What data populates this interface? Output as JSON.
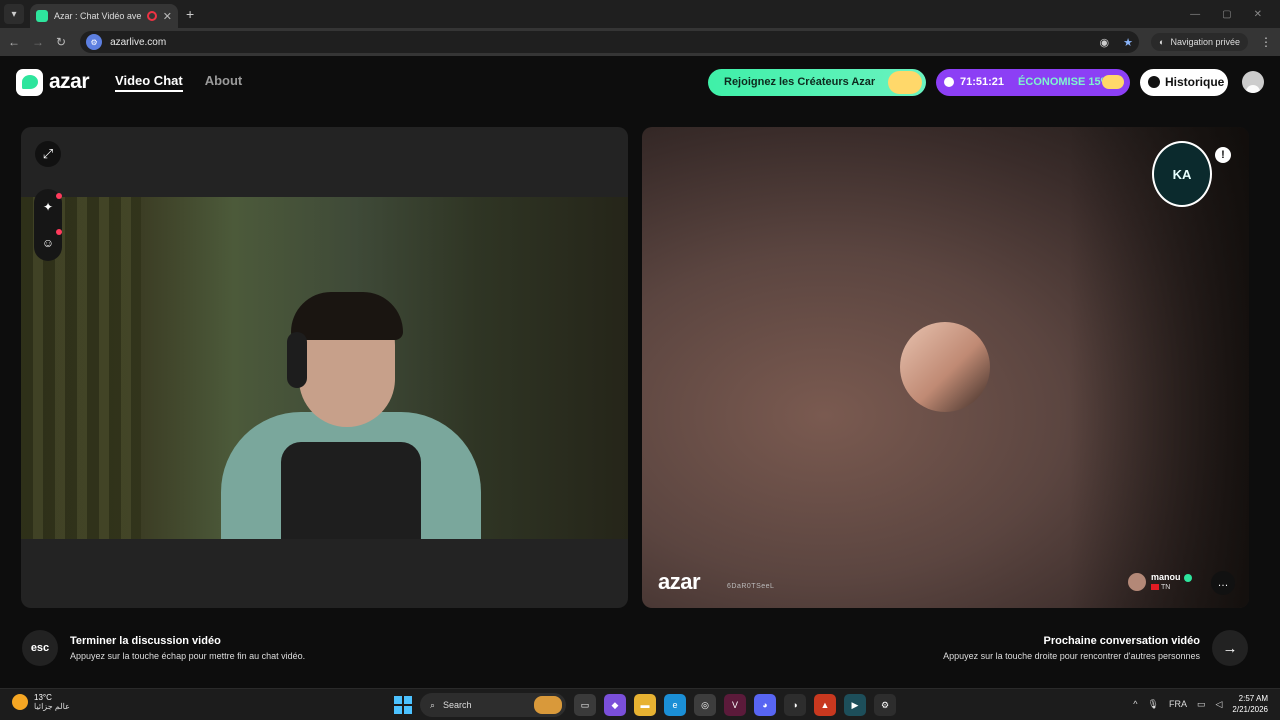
{
  "browser": {
    "tab_title": "Azar : Chat Vidéo avec de",
    "url": "azarlive.com",
    "private_label": "Navigation privée"
  },
  "header": {
    "brand": "azar",
    "nav": {
      "video_chat": "Video Chat",
      "about": "About"
    },
    "creators_button": "Rejoignez les Créateurs Azar",
    "promo_timer": "71:51:21",
    "promo_label": "ÉCONOMISE 15%",
    "history_button": "Historique"
  },
  "left_panel": {
    "expand_icon": "expand-icon",
    "tools": [
      "magic-wand-icon",
      "face-icon"
    ]
  },
  "right_panel": {
    "stream_badge": "KA",
    "watermark": "azar",
    "watermark_id": "6DaR0TSeeL",
    "partner": {
      "name": "manou",
      "country": "TN"
    }
  },
  "hints": {
    "esc_key": "esc",
    "end_title": "Terminer la discussion vidéo",
    "end_sub": "Appuyez sur la touche échap pour mettre fin au chat vidéo.",
    "next_title": "Prochaine conversation vidéo",
    "next_sub": "Appuyez sur la touche droite pour rencontrer d'autres personnes"
  },
  "taskbar": {
    "temperature": "13°C",
    "weather_loc": "عالم جزائيا",
    "search_placeholder": "Search",
    "language": "FRA",
    "time": "2:57 AM",
    "date": "2/21/2026"
  }
}
